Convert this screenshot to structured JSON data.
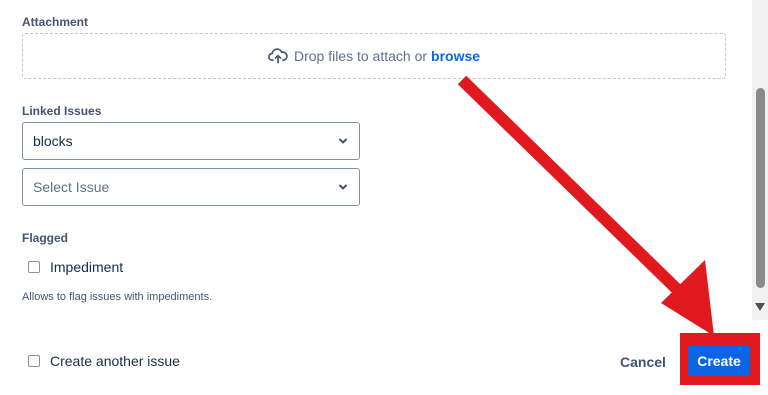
{
  "attachment": {
    "label": "Attachment",
    "drop_text": "Drop files to attach or",
    "browse_label": "browse"
  },
  "linked_issues": {
    "label": "Linked Issues",
    "relation_value": "blocks",
    "issue_placeholder": "Select Issue"
  },
  "flagged": {
    "label": "Flagged",
    "option_label": "Impediment",
    "helper_text": "Allows to flag issues with impediments."
  },
  "footer": {
    "create_another_label": "Create another issue",
    "cancel_label": "Cancel",
    "create_label": "Create"
  },
  "colors": {
    "primary": "#0c66e4",
    "annotation_red": "#e0191f"
  }
}
